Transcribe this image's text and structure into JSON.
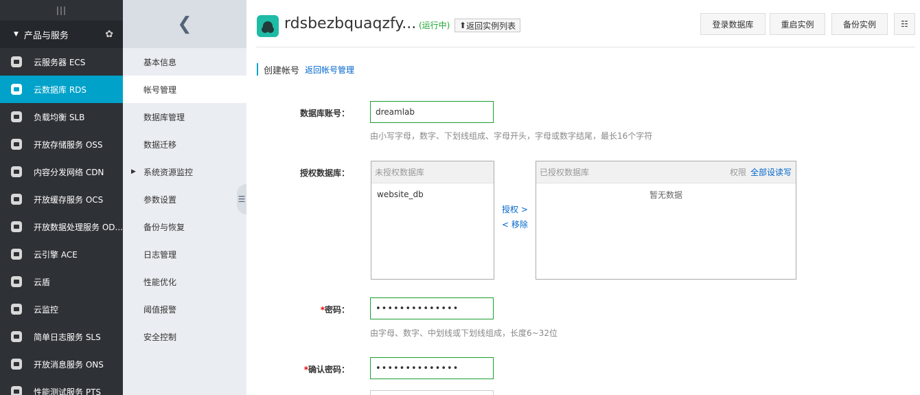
{
  "sidebar": {
    "toggle": "|||",
    "group_label": "产品与服务",
    "items": [
      {
        "label": "云服务器 ECS"
      },
      {
        "label": "云数据库 RDS"
      },
      {
        "label": "负载均衡 SLB"
      },
      {
        "label": "开放存储服务 OSS"
      },
      {
        "label": "内容分发网络 CDN"
      },
      {
        "label": "开放缓存服务 OCS"
      },
      {
        "label": "开放数据处理服务 OD..."
      },
      {
        "label": "云引擎 ACE"
      },
      {
        "label": "云盾"
      },
      {
        "label": "云监控"
      },
      {
        "label": "简单日志服务 SLS"
      },
      {
        "label": "开放消息服务 ONS"
      },
      {
        "label": "性能测试服务 PTS"
      }
    ]
  },
  "submenu": {
    "items": [
      {
        "label": "基本信息"
      },
      {
        "label": "帐号管理"
      },
      {
        "label": "数据库管理"
      },
      {
        "label": "数据迁移"
      },
      {
        "label": "系统资源监控"
      },
      {
        "label": "参数设置"
      },
      {
        "label": "备份与恢复"
      },
      {
        "label": "日志管理"
      },
      {
        "label": "性能优化"
      },
      {
        "label": "阈值报警"
      },
      {
        "label": "安全控制"
      }
    ]
  },
  "header": {
    "instance_name": "rdsbezbquaqzfy...",
    "status": "(运行中)",
    "back_to_list": "返回实例列表",
    "login_db": "登录数据库",
    "restart": "重启实例",
    "backup": "备份实例"
  },
  "page": {
    "title": "创建帐号",
    "back_link": "返回帐号管理"
  },
  "form": {
    "account_label": "数据库账号：",
    "account_value": "dreamlab",
    "account_hint": "由小写字母，数字、下划线组成、字母开头，字母或数字结尾，最长16个字符",
    "db_label": "授权数据库：",
    "unauth_header": "未授权数据库",
    "unauth_items": [
      "website_db"
    ],
    "grant": "授权 >",
    "remove": "< 移除",
    "auth_header": "已授权数据库",
    "perm_label": "权限",
    "set_all": "全部设读写",
    "empty": "暂无数据",
    "required_mark": "*",
    "password_label": "密码：",
    "password_value": "••••••••••••••",
    "password_hint": "由字母、数字、中划线或下划线组成，长度6~32位",
    "confirm_label": "确认密码：",
    "confirm_value": "••••••••••••••"
  },
  "colors": {
    "sidebar_bg": "#2e3136",
    "active": "#00a2ca",
    "link": "#0066cc",
    "input_border": "#1a9e2e",
    "status": "#1aa62f"
  }
}
